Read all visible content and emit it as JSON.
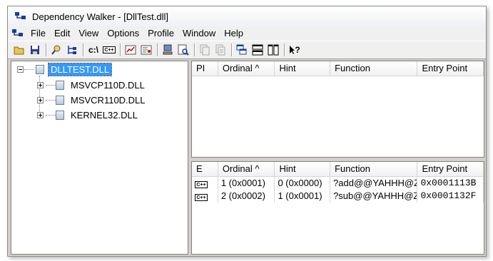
{
  "window": {
    "title": "Dependency Walker - [DllTest.dll]"
  },
  "menu": [
    "File",
    "Edit",
    "View",
    "Options",
    "Profile",
    "Window",
    "Help"
  ],
  "toolbar": {
    "console_label": "c:\\",
    "cpp_label": "C++",
    "help_label": "?"
  },
  "tree": {
    "root": "DLLTEST.DLL",
    "children": [
      "MSVCP110D.DLL",
      "MSVCR110D.DLL",
      "KERNEL32.DLL"
    ]
  },
  "imports_table": {
    "headers": [
      "PI",
      "Ordinal ^",
      "Hint",
      "Function",
      "Entry Point"
    ],
    "rows": []
  },
  "exports_table": {
    "headers": [
      "E",
      "Ordinal ^",
      "Hint",
      "Function",
      "Entry Point"
    ],
    "rows": [
      {
        "icon": "C++",
        "ordinal": "1 (0x0001)",
        "hint": "0 (0x0000)",
        "function": "?add@@YAHHH@Z",
        "entry": "0x0001113B"
      },
      {
        "icon": "C++",
        "ordinal": "2 (0x0002)",
        "hint": "1 (0x0001)",
        "function": "?sub@@YAHHH@Z",
        "entry": "0x0001132F"
      }
    ]
  }
}
